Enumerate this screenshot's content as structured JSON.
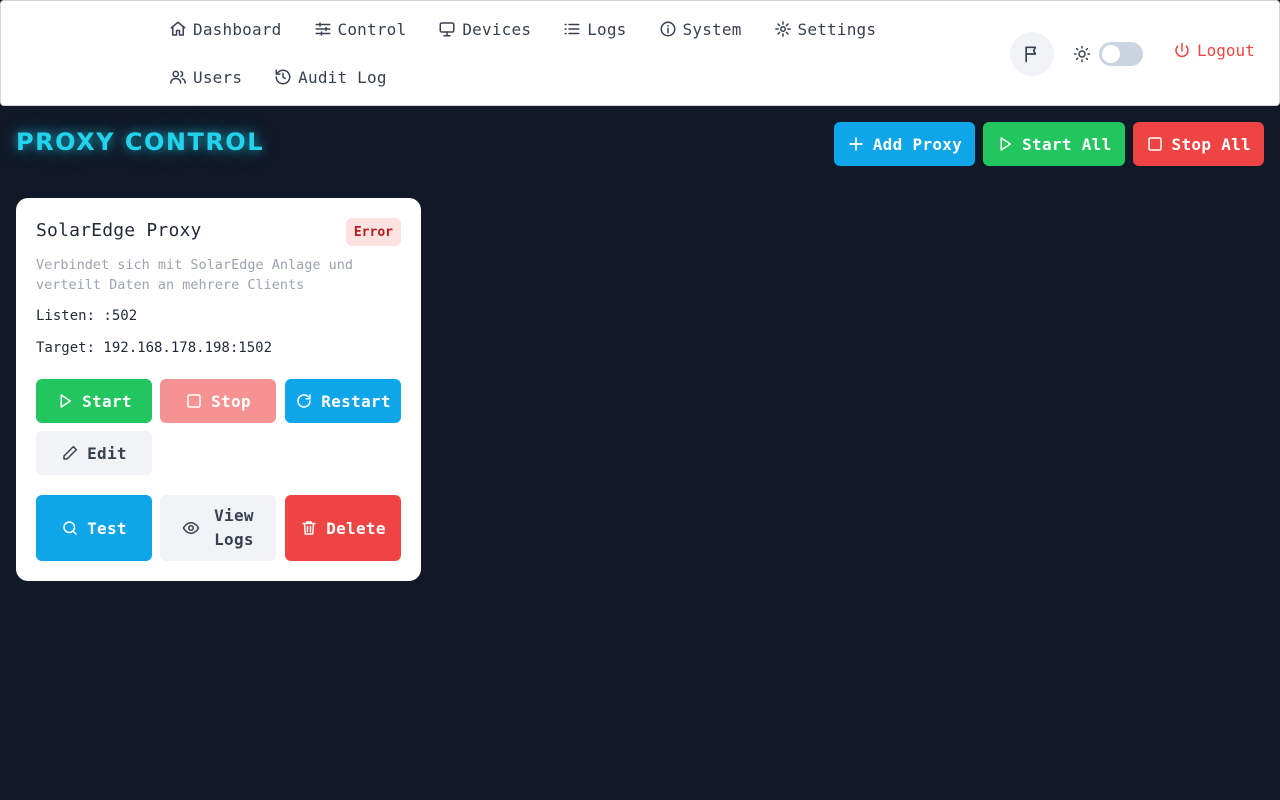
{
  "nav": {
    "items": [
      {
        "label": "Dashboard",
        "icon": "home-icon"
      },
      {
        "label": "Control",
        "icon": "sliders-icon"
      },
      {
        "label": "Devices",
        "icon": "monitor-icon"
      },
      {
        "label": "Logs",
        "icon": "list-icon"
      },
      {
        "label": "System",
        "icon": "info-icon"
      },
      {
        "label": "Settings",
        "icon": "gear-icon"
      },
      {
        "label": "Users",
        "icon": "users-icon"
      },
      {
        "label": "Audit Log",
        "icon": "history-icon"
      }
    ],
    "logout_label": "Logout"
  },
  "page": {
    "title": "PROXY CONTROL"
  },
  "toolbar": {
    "add_label": "Add Proxy",
    "start_all_label": "Start All",
    "stop_all_label": "Stop All"
  },
  "proxy": {
    "name": "SolarEdge Proxy",
    "status": "Error",
    "description": "Verbindet sich mit SolarEdge Anlage und verteilt Daten an mehrere Clients",
    "listen": "Listen: :502",
    "target": "Target: 192.168.178.198:1502",
    "buttons": {
      "start": "Start",
      "stop": "Stop",
      "restart": "Restart",
      "edit": "Edit",
      "test": "Test",
      "view_logs_line1": "View",
      "view_logs_line2": "Logs",
      "delete": "Delete"
    }
  },
  "colors": {
    "background": "#111827",
    "accent_cyan": "#22d3ee",
    "primary_blue": "#0ea5e9",
    "success_green": "#22c55e",
    "danger_red": "#ef4444",
    "stop_disabled": "#f59393",
    "error_badge_bg": "#fde2e2"
  }
}
